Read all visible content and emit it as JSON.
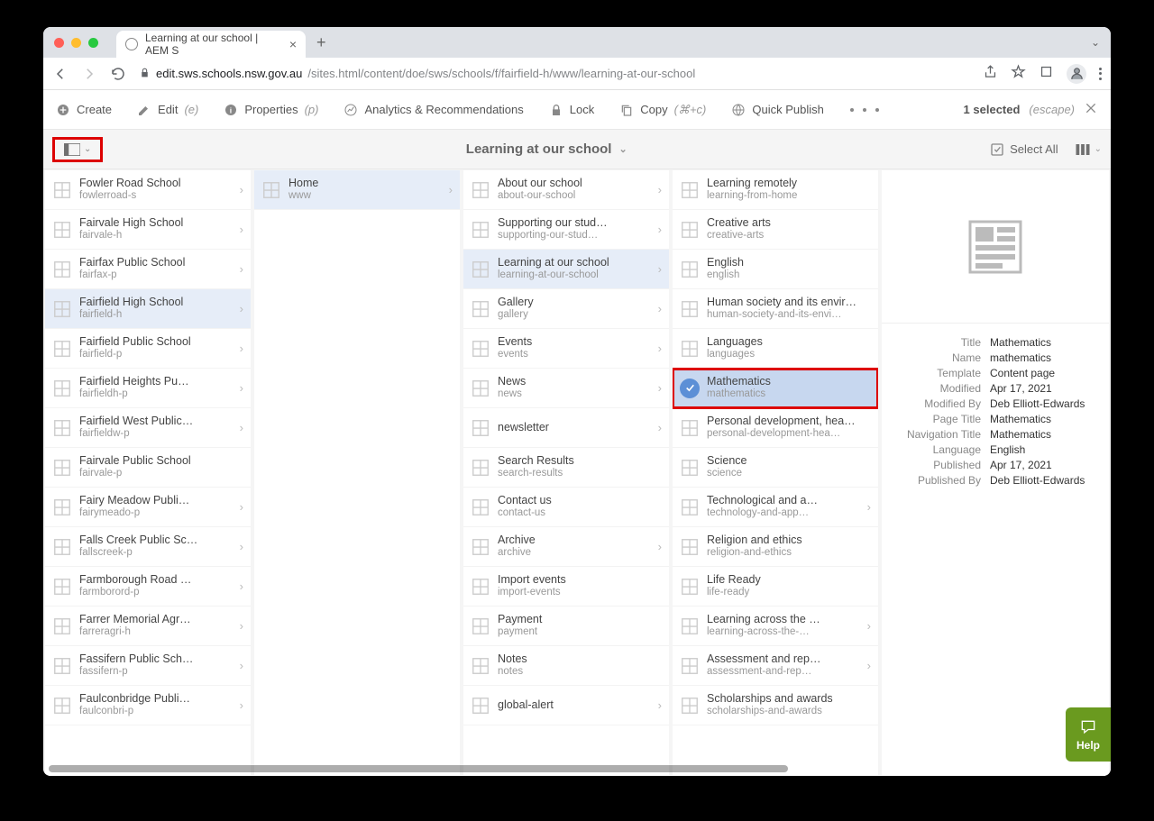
{
  "browser": {
    "tab_title": "Learning at our school | AEM S",
    "url_host": "edit.sws.schools.nsw.gov.au",
    "url_path": "/sites.html/content/doe/sws/schools/f/fairfield-h/www/learning-at-our-school"
  },
  "actions": {
    "create": "Create",
    "edit": "Edit",
    "edit_sc": "(e)",
    "properties": "Properties",
    "properties_sc": "(p)",
    "analytics": "Analytics & Recommendations",
    "lock": "Lock",
    "copy": "Copy",
    "copy_sc": "(⌘+c)",
    "quick_publish": "Quick Publish",
    "selected_count": "1 selected",
    "escape": "(escape)"
  },
  "header": {
    "title": "Learning at our school",
    "select_all": "Select All"
  },
  "col1": [
    {
      "t": "Fowler Road School",
      "s": "fowlerroad-s",
      "c": true
    },
    {
      "t": "Fairvale High School",
      "s": "fairvale-h",
      "c": true
    },
    {
      "t": "Fairfax Public School",
      "s": "fairfax-p",
      "c": true
    },
    {
      "t": "Fairfield High School",
      "s": "fairfield-h",
      "c": true,
      "active": true
    },
    {
      "t": "Fairfield Public School",
      "s": "fairfield-p",
      "c": true
    },
    {
      "t": "Fairfield Heights Pu…",
      "s": "fairfieldh-p",
      "c": true
    },
    {
      "t": "Fairfield West Public…",
      "s": "fairfieldw-p",
      "c": true
    },
    {
      "t": "Fairvale Public School",
      "s": "fairvale-p"
    },
    {
      "t": "Fairy Meadow Publi…",
      "s": "fairymeado-p",
      "c": true
    },
    {
      "t": "Falls Creek Public Sc…",
      "s": "fallscreek-p",
      "c": true
    },
    {
      "t": "Farmborough Road …",
      "s": "farmborord-p",
      "c": true
    },
    {
      "t": "Farrer Memorial Agr…",
      "s": "farreragri-h",
      "c": true
    },
    {
      "t": "Fassifern Public Sch…",
      "s": "fassifern-p",
      "c": true
    },
    {
      "t": "Faulconbridge Publi…",
      "s": "faulconbri-p",
      "c": true
    }
  ],
  "col2": [
    {
      "t": "Home",
      "s": "www",
      "c": true,
      "active": true
    }
  ],
  "col3": [
    {
      "t": "About our school",
      "s": "about-our-school",
      "c": true
    },
    {
      "t": "Supporting our stud…",
      "s": "supporting-our-stud…",
      "c": true
    },
    {
      "t": "Learning at our school",
      "s": "learning-at-our-school",
      "c": true,
      "active": true
    },
    {
      "t": "Gallery",
      "s": "gallery",
      "c": true
    },
    {
      "t": "Events",
      "s": "events",
      "c": true
    },
    {
      "t": "News",
      "s": "news",
      "c": true
    },
    {
      "t": "newsletter",
      "s": "",
      "c": true
    },
    {
      "t": "Search Results",
      "s": "search-results"
    },
    {
      "t": "Contact us",
      "s": "contact-us"
    },
    {
      "t": "Archive",
      "s": "archive",
      "c": true
    },
    {
      "t": "Import events",
      "s": "import-events"
    },
    {
      "t": "Payment",
      "s": "payment"
    },
    {
      "t": "Notes",
      "s": "notes"
    },
    {
      "t": "global-alert",
      "s": "",
      "c": true
    }
  ],
  "col4": [
    {
      "t": "Learning remotely",
      "s": "learning-from-home"
    },
    {
      "t": "Creative arts",
      "s": "creative-arts"
    },
    {
      "t": "English",
      "s": "english"
    },
    {
      "t": "Human society and its envir…",
      "s": "human-society-and-its-envi…"
    },
    {
      "t": "Languages",
      "s": "languages"
    },
    {
      "t": "Mathematics",
      "s": "mathematics",
      "selected": true
    },
    {
      "t": "Personal development, hea…",
      "s": "personal-development-hea…"
    },
    {
      "t": "Science",
      "s": "science"
    },
    {
      "t": "Technological and a…",
      "s": "technology-and-app…",
      "c": true
    },
    {
      "t": "Religion and ethics",
      "s": "religion-and-ethics"
    },
    {
      "t": "Life Ready",
      "s": "life-ready"
    },
    {
      "t": "Learning across the …",
      "s": "learning-across-the-…",
      "c": true
    },
    {
      "t": "Assessment and rep…",
      "s": "assessment-and-rep…",
      "c": true
    },
    {
      "t": "Scholarships and awards",
      "s": "scholarships-and-awards"
    }
  ],
  "detail": {
    "kv": [
      {
        "k": "Title",
        "v": "Mathematics"
      },
      {
        "k": "Name",
        "v": "mathematics"
      },
      {
        "k": "Template",
        "v": "Content page"
      },
      {
        "k": "Modified",
        "v": "Apr 17, 2021"
      },
      {
        "k": "Modified By",
        "v": "Deb Elliott-Edwards"
      },
      {
        "k": "Page Title",
        "v": "Mathematics"
      },
      {
        "k": "Navigation Title",
        "v": "Mathematics"
      },
      {
        "k": "Language",
        "v": "English"
      },
      {
        "k": "Published",
        "v": "Apr 17, 2021"
      },
      {
        "k": "Published By",
        "v": "Deb Elliott-Edwards"
      }
    ]
  },
  "help": "Help"
}
